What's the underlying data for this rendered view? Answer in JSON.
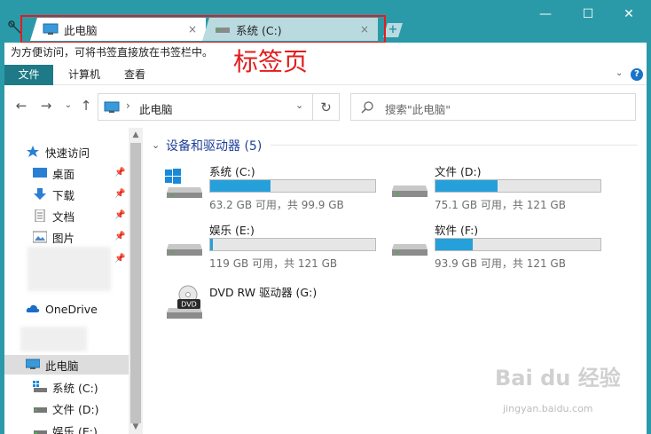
{
  "tabs": [
    {
      "label": "此电脑",
      "close": "×"
    },
    {
      "label": "系统 (C:)",
      "close": "×"
    }
  ],
  "new_tab": "+",
  "window": {
    "minimize": "—",
    "maximize": "☐",
    "close": "✕"
  },
  "bookmark_bar": {
    "text": "为方便访问，可将书签直接放在书签栏中。"
  },
  "annotation": "标签页",
  "ribbon": {
    "file": "文件",
    "computer": "计算机",
    "view": "查看",
    "help": "?"
  },
  "address": {
    "path": "此电脑",
    "separator": "›"
  },
  "search": {
    "placeholder": "搜索\"此电脑\""
  },
  "nav": {
    "quick_access": "快速访问",
    "items": [
      {
        "label": "桌面"
      },
      {
        "label": "下载"
      },
      {
        "label": "文档"
      },
      {
        "label": "图片"
      }
    ],
    "onedrive": "OneDrive",
    "this_pc": "此电脑",
    "drives": [
      {
        "label": "系统 (C:)"
      },
      {
        "label": "文件 (D:)"
      },
      {
        "label": "娱乐 (E:)"
      }
    ]
  },
  "main": {
    "section_title": "设备和驱动器 (5)",
    "drives": [
      {
        "name": "系统 (C:)",
        "free": "63.2 GB 可用，共 99.9 GB",
        "used_fraction": 0.367
      },
      {
        "name": "文件 (D:)",
        "free": "75.1 GB 可用，共 121 GB",
        "used_fraction": 0.379
      },
      {
        "name": "娱乐 (E:)",
        "free": "119 GB 可用，共 121 GB",
        "used_fraction": 0.017
      },
      {
        "name": "软件 (F:)",
        "free": "93.9 GB 可用，共 121 GB",
        "used_fraction": 0.224
      }
    ],
    "dvd": {
      "name": "DVD RW 驱动器 (G:)",
      "badge": "DVD"
    }
  },
  "watermark": {
    "brand": "Bai du 经验",
    "url": "jingyan.baidu.com"
  },
  "colors": {
    "accent": "#2b9aa8",
    "ribbon_file": "#1f7a87",
    "bar_fill": "#26a0da",
    "highlight": "#e41c1c"
  }
}
